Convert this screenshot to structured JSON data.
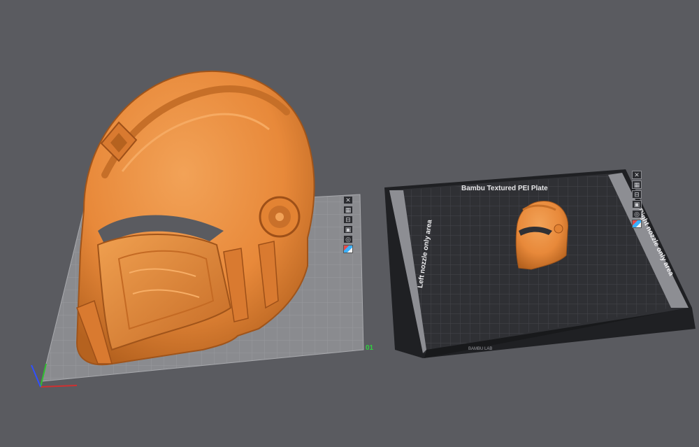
{
  "scene": {
    "background_color": "#5a5b60",
    "model_color": "#e8893a",
    "plate1": {
      "index_label": "01",
      "surface_color": "#8a8b8f",
      "toolbar_icons": [
        "close-icon",
        "arrange-icon",
        "orient-icon",
        "lock-icon",
        "settings-icon",
        "color-icon"
      ]
    },
    "plate2": {
      "title": "Bambu Textured PEI Plate",
      "left_zone_label": "Left nozzle only area",
      "right_zone_label": "Right nozzle only area",
      "bottom_logo": "BAMBU LAB",
      "surface_color": "#2f3034",
      "toolbar_icons": [
        "close-icon",
        "arrange-icon",
        "orient-icon",
        "lock-icon",
        "settings-icon",
        "color-icon"
      ]
    },
    "axes": {
      "x_color": "#d03030",
      "y_color": "#30c030",
      "z_color": "#3050ff"
    }
  }
}
